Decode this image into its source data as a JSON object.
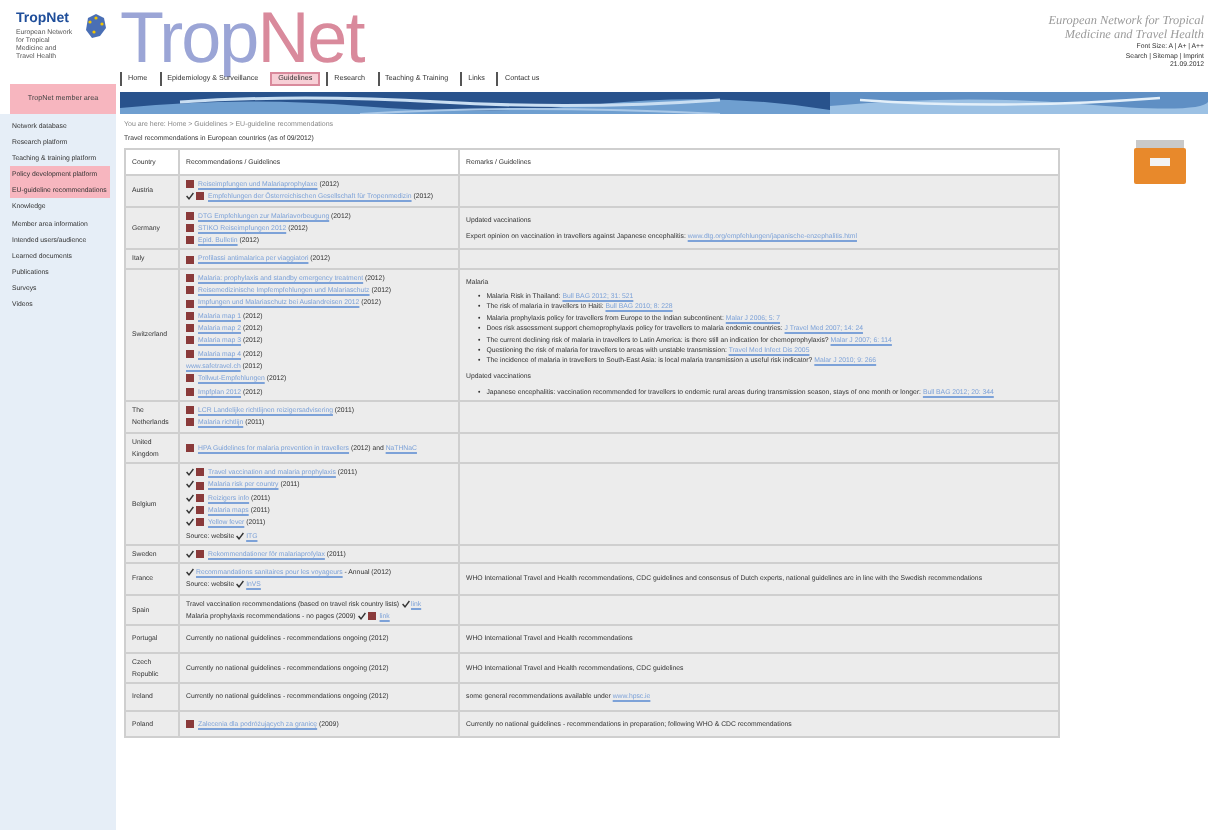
{
  "logo": {
    "name": "TropNet",
    "tagline": "European Network for Tropical Medicine and Travel Health"
  },
  "title": {
    "parts": [
      {
        "text": "Trop",
        "color": "#9ba5d6"
      },
      {
        "text": "Net",
        "color": "#d98a9c"
      }
    ]
  },
  "tabs": [
    {
      "label": "Home",
      "selected": false
    },
    {
      "label": "Epidemiology & Surveillance",
      "selected": false
    },
    {
      "label": "Guidelines",
      "selected": true
    },
    {
      "label": "Research",
      "selected": false
    },
    {
      "label": "Teaching & Training",
      "selected": false
    },
    {
      "label": "Links",
      "selected": false
    },
    {
      "label": "Contact us",
      "selected": false
    }
  ],
  "header_right": {
    "network": "European Network for Tropical Medicine and Travel Health",
    "font_size": "Font Size: A | A+ | A++",
    "links": "Search | Sitemap | Imprint",
    "date": "21.09.2012"
  },
  "member_area": "TropNet member area",
  "sidebar": {
    "items": [
      {
        "label": "Network database",
        "selected": false
      },
      {
        "label": "Research platform",
        "selected": false
      },
      {
        "label": "Teaching & training platform",
        "selected": false
      },
      {
        "label": "Policy development platform",
        "selected": true
      },
      {
        "label": "EU-guideline recommendations",
        "selected": true
      },
      {
        "label": "Knowledge",
        "selected": false
      },
      {
        "label": "Member area information",
        "selected": false
      },
      {
        "label": "Intended users/audience",
        "selected": false
      },
      {
        "label": "Learned documents",
        "selected": false
      },
      {
        "label": "Publications",
        "selected": false
      },
      {
        "label": "Surveys",
        "selected": false
      },
      {
        "label": "Videos",
        "selected": false
      }
    ]
  },
  "breadcrumb": "You are here: Home > Guidelines > EU-guideline recommendations",
  "intro": "Travel recommendations in European countries (as of 09/2012)",
  "table": {
    "columns": [
      "Country",
      "Recommendations / Guidelines",
      "Remarks / Guidelines"
    ],
    "rows": [
      {
        "country": "Austria",
        "items": [
          {
            "ticked": false,
            "pdf": true,
            "link": "Reiseimpfungen und Malariaprophylaxe",
            "note": "(2012)"
          },
          {
            "ticked": true,
            "pdf": true,
            "link": "Empfehlungen der Österreichischen Gesellschaft für Tropenmedizin",
            "note": "(2012)"
          }
        ],
        "remarks": []
      },
      {
        "country": "Germany",
        "items": [
          {
            "ticked": false,
            "pdf": true,
            "link": "DTG Empfehlungen zur Malariavorbeugung",
            "note": "(2012)"
          },
          {
            "ticked": false,
            "pdf": true,
            "link": "STIKO Reiseimpfungen 2012",
            "note": "(2012)"
          },
          {
            "ticked": false,
            "pdf": true,
            "link": "Epid. Bulletin",
            "note": "(2012)"
          }
        ],
        "remarks": [
          {
            "kind": "para",
            "text": "Updated vaccinations"
          },
          {
            "kind": "para",
            "text": "Expert opinion on vaccination in travellers against Japanese encephalitis:",
            "link": "www.dtg.org/empfehlungen/japanische-enzephalitis.html"
          }
        ]
      },
      {
        "country": "Italy",
        "items": [
          {
            "ticked": false,
            "pdf": true,
            "link": "Profilassi antimalarica per viaggiatori",
            "note": "(2012)"
          }
        ],
        "remarks": []
      },
      {
        "country": "Switzerland",
        "items": [
          {
            "ticked": false,
            "pdf": true,
            "link": "Malaria: prophylaxis and standby emergency treatment",
            "note": "(2012)"
          },
          {
            "ticked": false,
            "pdf": true,
            "link": "Reisemedizinische Impfempfehlungen und Malariaschutz",
            "note": "(2012)"
          },
          {
            "ticked": false,
            "pdf": true,
            "link": "Impfungen und Malariaschutz bei Auslandreisen 2012",
            "note": "(2012)"
          },
          {
            "ticked": false,
            "pdf": true,
            "link": "Malaria map 1",
            "note": "(2012)"
          },
          {
            "ticked": false,
            "pdf": true,
            "link": "Malaria map 2",
            "note": "(2012)"
          },
          {
            "ticked": false,
            "pdf": true,
            "link": "Malaria map 3",
            "note": "(2012)"
          },
          {
            "ticked": false,
            "pdf": true,
            "link": "Malaria map 4",
            "note": "(2012)"
          },
          {
            "ticked": false,
            "pdf": false,
            "link": "www.safetravel.ch",
            "note": "(2012)"
          },
          {
            "ticked": false,
            "pdf": true,
            "link": "Tollwut-Empfehlungen",
            "note": "(2012)"
          },
          {
            "ticked": false,
            "pdf": true,
            "link": "Impfplan 2012",
            "note": "(2012)"
          }
        ],
        "remarks": [
          {
            "kind": "para",
            "text": "Malaria"
          },
          {
            "kind": "list",
            "bullet": "•",
            "items": [
              {
                "text": "Malaria Risk in Thailand:",
                "link": "Bull BAG 2012; 31: 521"
              },
              {
                "text": "The risk of malaria in travellers to Haiti:",
                "link": "Bull BAG 2010; 8: 228"
              },
              {
                "text": "Malaria prophylaxis policy for travellers from Europe to the Indian subcontinent:",
                "link": "Malar J 2006; 5: 7"
              },
              {
                "text": "Does risk assessment support chemoprophylaxis policy for travellers to malaria endemic countries:",
                "link": "J Travel Med 2007; 14: 24"
              },
              {
                "text": "The current declining risk of malaria in travellers to Latin America: is there still an indication for chemoprophylaxis?",
                "link": "Malar J 2007; 6: 114"
              },
              {
                "text": "Questioning the risk of malaria for travellers to areas with unstable transmission:",
                "link": "Travel Med Infect Dis 2005"
              },
              {
                "text": "The incidence of malaria in travellers to South-East Asia: is local malaria transmission a useful risk indicator?",
                "link": "Malar J 2010; 9: 266"
              }
            ]
          },
          {
            "kind": "para",
            "text": "Updated vaccinations"
          },
          {
            "kind": "list",
            "bullet": "•",
            "items": [
              {
                "text": "Japanese encephalitis: vaccination recommended for travellers to endemic rural areas during transmission season, stays of one month or longer:",
                "link": "Bull BAG 2012; 20: 344"
              }
            ]
          }
        ]
      },
      {
        "country": "The Netherlands",
        "items": [
          {
            "ticked": false,
            "pdf": true,
            "link": "LCR Landelijke richtlijnen reizigersadvisering",
            "note": "(2011)"
          },
          {
            "ticked": false,
            "pdf": true,
            "link": "Malaria richtlijn",
            "note": "(2011)"
          }
        ],
        "remarks": []
      },
      {
        "country": "United Kingdom",
        "items": [
          {
            "ticked": false,
            "pdf": true,
            "link": "HPA Guidelines for malaria prevention in travellers",
            "note": "(2012) and",
            "link2": "NaTHNaC"
          }
        ],
        "remarks": []
      },
      {
        "country": "Belgium",
        "items": [
          {
            "ticked": true,
            "pdf": true,
            "link": "Travel vaccination and malaria prophylaxis",
            "note": "(2011)"
          },
          {
            "ticked": true,
            "pdf": true,
            "link": "Malaria risk per country",
            "note": "(2011)"
          },
          {
            "ticked": true,
            "pdf": true,
            "link": "Reizigers info",
            "note": "(2011)"
          },
          {
            "ticked": true,
            "pdf": true,
            "link": "Malaria maps",
            "note": "(2011)"
          },
          {
            "ticked": true,
            "pdf": true,
            "link": "Yellow fever",
            "note": "(2011)"
          },
          {
            "ticked": true,
            "pdf": false,
            "lead": "Source: website",
            "link": "ITG"
          }
        ],
        "remarks": []
      },
      {
        "country": "Sweden",
        "items": [
          {
            "ticked": true,
            "pdf": true,
            "link": "Rekommendationer för malariaprofylax",
            "note": "(2011)"
          }
        ],
        "remarks": []
      },
      {
        "country": "France",
        "items": [
          {
            "ticked": true,
            "pdf": false,
            "link": "Recommandations sanitaires pour les voyageurs",
            "note": "- Annual (2012)"
          },
          {
            "ticked": true,
            "pdf": false,
            "lead": "Source: website",
            "link": "InVS"
          }
        ],
        "remarks": [
          {
            "kind": "para",
            "text": "WHO International Travel and Health recommendations, CDC guidelines and consensus of Dutch experts, national guidelines are in line with the Swedish recommendations"
          }
        ]
      },
      {
        "country": "Spain",
        "items": [
          {
            "ticked": true,
            "pdf": false,
            "lead": "Travel vaccination recommendations (based on travel risk country lists)",
            "link": "link"
          },
          {
            "ticked": true,
            "pdf": true,
            "lead": "Malaria prophylaxis recommendations - no pages (2009)",
            "link": "link"
          }
        ],
        "remarks": []
      },
      {
        "country": "Portugal",
        "items": [
          {
            "ticked": false,
            "pdf": false,
            "lead": "Currently no national guidelines - recommendations ongoing (2012)"
          }
        ],
        "remarks": [
          {
            "kind": "para",
            "text": "WHO International Travel and Health recommendations"
          }
        ]
      },
      {
        "country": "Czech Republic",
        "items": [
          {
            "ticked": false,
            "pdf": false,
            "lead": "Currently no national guidelines - recommendations ongoing (2012)"
          }
        ],
        "remarks": [
          {
            "kind": "para",
            "text": "WHO International Travel and Health recommendations, CDC guidelines"
          }
        ]
      },
      {
        "country": "Ireland",
        "items": [
          {
            "ticked": false,
            "pdf": false,
            "lead": "Currently no national guidelines - recommendations ongoing (2012)"
          }
        ],
        "remarks": [
          {
            "kind": "para",
            "text": "some general recommendations available under",
            "link": "www.hpsc.ie"
          }
        ]
      },
      {
        "country": "Poland",
        "items": [
          {
            "ticked": false,
            "pdf": true,
            "link": "Zalecenia dla podróżujących za granicę",
            "note": "(2009)"
          }
        ],
        "remarks": [
          {
            "kind": "para",
            "text": "Currently no national guidelines - recommendations in preparation; following WHO & CDC recommendations"
          }
        ]
      }
    ]
  }
}
